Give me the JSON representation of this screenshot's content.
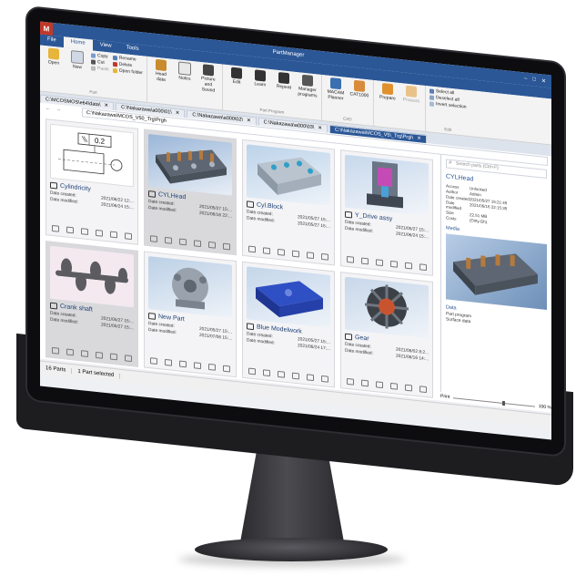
{
  "app": {
    "title": "PartManager",
    "logo": "M"
  },
  "menu": {
    "tabs": [
      "File",
      "Home",
      "View",
      "Tools"
    ],
    "active": "Home"
  },
  "ribbon": {
    "open": "Open",
    "new": "New",
    "copy": "Copy",
    "cut": "Cut",
    "paste": "Paste",
    "rename": "Rename",
    "delete": "Delete",
    "open_folder": "Open folder",
    "head_data": "Head data",
    "notes": "Notes",
    "picture_sound": "Picture and Sound",
    "edit": "Edit",
    "learn": "Learn",
    "repeat": "Repeat",
    "manager_programs": "Manager programs",
    "macam_planner": "MACAM Planner",
    "cat1000": "CAT1000",
    "prepare": "Prepare",
    "process": "Process",
    "select_all": "Select all",
    "deselect_all": "Deselect all",
    "invert_selection": "Invert selection",
    "group_part": "Part",
    "group_part_program": "Part Program",
    "group_cad": "CAD",
    "group_edit": "Edit"
  },
  "doc_tabs": [
    {
      "label": "C:\\MCOSMOS\\e64\\data\\"
    },
    {
      "label": "C:\\Nakazawa\\a000\\01\\"
    },
    {
      "label": "C:\\Nakazawa\\a000\\02\\"
    },
    {
      "label": "C:\\Nakazawa\\a000\\03\\"
    },
    {
      "label": "C:\\Nakazawa\\MCOS_V5\\_Trg\\Prgh"
    }
  ],
  "address": {
    "path": "C:\\Nakazawa\\MCOS_V50_Trg\\Prgh"
  },
  "parts": [
    {
      "name": "Cylindricity",
      "created": "2021/06/22 12:...",
      "modified": "2021/06/24 15:...",
      "thumb": "drawing"
    },
    {
      "name": "CYLHead",
      "created": "2021/05/27 15:...",
      "modified": "2021/06/16 22:...",
      "thumb": "cylhead",
      "selected": true
    },
    {
      "name": "Cyl.Block",
      "created": "2021/05/27 15:...",
      "modified": "2021/05/27 15:...",
      "thumb": "block"
    },
    {
      "name": "Y_Drive assy",
      "created": "2021/05/27 15:...",
      "modified": "2021/06/24 15:...",
      "thumb": "ydrive"
    },
    {
      "name": "Crank shaft",
      "created": "2021/05/27 15:...",
      "modified": "2021/05/27 15:...",
      "thumb": "crank"
    },
    {
      "name": "New Part",
      "created": "2021/05/27 15:...",
      "modified": "2021/07/06 15:...",
      "thumb": "newpart"
    },
    {
      "name": "Blue Modelwork",
      "created": "2021/05/27 15:...",
      "modified": "2021/06/24 17:...",
      "thumb": "blue"
    },
    {
      "name": "Gear",
      "created": "2021/06/02 8:2...",
      "modified": "2021/06/16 14:...",
      "thumb": "gear"
    }
  ],
  "labels": {
    "date_created": "Date created:",
    "date_modified": "Date modified:"
  },
  "sidebar": {
    "search_placeholder": "Search parts (Ctrl+F)",
    "title": "CYLHead",
    "props": [
      [
        "Access",
        "Unlocked"
      ],
      [
        "Author",
        "Admin"
      ],
      [
        "Date created",
        "2021/05/27 15:21:45"
      ],
      [
        "Date modified",
        "2021/06/16 22:15:35"
      ],
      [
        "Size",
        "22.51 MB"
      ],
      [
        "Costs",
        "(Dirty.Gh)"
      ]
    ],
    "media_label": "Media",
    "data_label": "Data",
    "data_items": [
      "Part program",
      "Surface data"
    ]
  },
  "zoom": {
    "label": "Print",
    "value": "100 %"
  },
  "status": {
    "count": "16 Parts",
    "selection": "1 Part selected"
  }
}
